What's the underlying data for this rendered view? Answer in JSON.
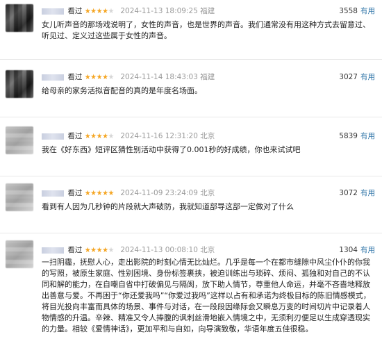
{
  "reviews": [
    {
      "status": "看过",
      "rating": 4,
      "time": "2024-11-13 18:09:25",
      "location": "福建",
      "votes": "3558",
      "useful_label": "有用",
      "content": "女儿听声音的那场戏说明了，女性的声音，也是世界的声音。我们通常没有用这种方式去留意过、听见过、定义过这些属于女性的声音。"
    },
    {
      "status": "看过",
      "rating": 4,
      "time": "2024-11-14 18:43:03",
      "location": "福建",
      "votes": "3027",
      "useful_label": "有用",
      "content": "给母亲的家务活拟音配音的真的是年度名场面。"
    },
    {
      "status": "看过",
      "rating": 4,
      "time": "2024-11-16 12:31:20",
      "location": "北京",
      "votes": "5839",
      "useful_label": "有用",
      "content": "我在《好东西》短评区猜性别活动中获得了0.001秒的好成绩，你也来试试吧"
    },
    {
      "status": "看过",
      "rating": 5,
      "time": "2024-11-09 23:24:09",
      "location": "北京",
      "votes": "3072",
      "useful_label": "有用",
      "content": "看到有人因为几秒钟的片段就大声破防，我就知道部导这部一定做对了什么"
    },
    {
      "status": "看过",
      "rating": 4,
      "time": "2024-11-13 00:08:10",
      "location": "北京",
      "votes": "1304",
      "useful_label": "有用",
      "content": "一扫阴霾，抚慰人心，走出影院的时刻心情无比灿烂。几乎是每一个在都市缝隙中风尘仆仆的你我的写照，被原生家庭、性别困境、身份标签裹挟，被迫训练出与琐碎、烦闷、孤独和对自己的不认同和解的能力，在自嘲自省中打破偏见与隔阂，放下助人情节，尊重他人命运，并毫不吝啬地释放出善意与爱。不再困于“你还爱我吗”“你爱过我吗”这样以占有和承诺为终极目标的陈旧情感模式，将目光投向丰富而具体的场景、事件与对话，在一段段因缘际会又瞬息万变的时间切片中记录着人物情感的升温。辛辣、精准又令人捧腹的讽刺丝滑地嵌入情境之中，无须利刃便足以生成穿透现实的力量。相较《爱情神话》，更加平和与自如，向导演致敬，华语年度五佳很稳。"
    }
  ]
}
